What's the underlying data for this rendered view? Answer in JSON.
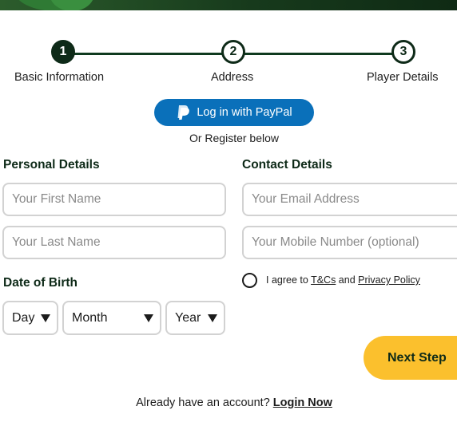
{
  "stepper": {
    "steps": [
      {
        "number": "1",
        "label": "Basic Information",
        "state": "active"
      },
      {
        "number": "2",
        "label": "Address",
        "state": "inactive"
      },
      {
        "number": "3",
        "label": "Player Details",
        "state": "inactive"
      }
    ]
  },
  "paypal": {
    "label": "Log in with PayPal",
    "icon": "paypal-icon",
    "color": "#0a70ba"
  },
  "or_register": "Or Register below",
  "personal": {
    "title": "Personal Details",
    "first_name_placeholder": "Your First Name",
    "last_name_placeholder": "Your Last Name"
  },
  "contact": {
    "title": "Contact Details",
    "email_placeholder": "Your Email Address",
    "mobile_placeholder": "Your Mobile Number (optional)"
  },
  "dob": {
    "title": "Date of Birth",
    "day": "Day",
    "month": "Month",
    "year": "Year"
  },
  "terms": {
    "prefix": "I agree to ",
    "tcs": "T&Cs",
    "middle": " and ",
    "privacy": "Privacy Policy",
    "checked": false
  },
  "next_step": {
    "label": "Next Step",
    "color": "#fbc02d"
  },
  "login": {
    "prompt": "Already have an account?",
    "link": "Login Now"
  },
  "colors": {
    "brand_dark_green": "#0e2a18",
    "banner_green": "#173a1c"
  }
}
